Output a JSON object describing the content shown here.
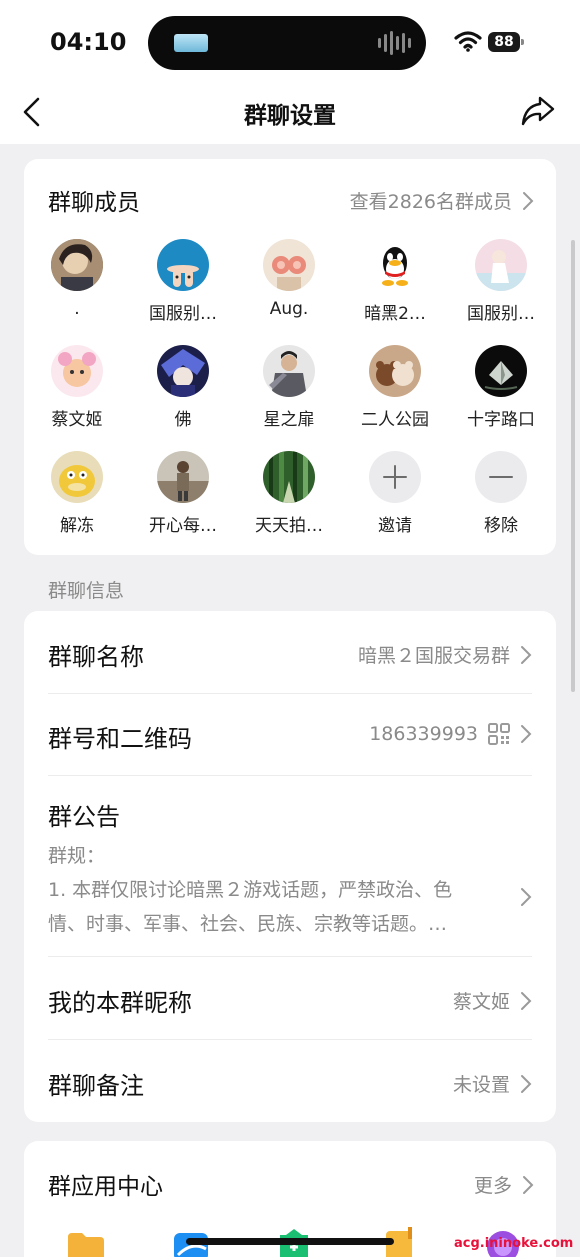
{
  "status_bar": {
    "time": "04:10",
    "battery": "88"
  },
  "nav": {
    "title": "群聊设置"
  },
  "members": {
    "title": "群聊成员",
    "view_all": "查看2826名群成员",
    "items": [
      {
        "name": "."
      },
      {
        "name": "国服别…"
      },
      {
        "name": "Aug."
      },
      {
        "name": "暗黑2…"
      },
      {
        "name": "国服别…"
      },
      {
        "name": "蔡文姬"
      },
      {
        "name": "佛"
      },
      {
        "name": "星之扉"
      },
      {
        "name": "二人公园"
      },
      {
        "name": "十字路口"
      },
      {
        "name": "解冻"
      },
      {
        "name": "开心每…"
      },
      {
        "name": "天天拍…"
      }
    ],
    "invite_label": "邀请",
    "remove_label": "移除"
  },
  "info_section_label": "群聊信息",
  "info": {
    "name_label": "群聊名称",
    "name_value": "暗黑２国服交易群",
    "number_label": "群号和二维码",
    "number_value": "186339993",
    "notice_label": "群公告",
    "notice_line1": "群规：",
    "notice_line2": "1. 本群仅限讨论暗黑２游戏话题，严禁政治、色",
    "notice_line3": "情、时事、军事、社会、民族、宗教等话题。…",
    "nickname_label": "我的本群昵称",
    "nickname_value": "蔡文姬",
    "remark_label": "群聊备注",
    "remark_value": "未设置"
  },
  "apps": {
    "title": "群应用中心",
    "more": "更多"
  },
  "watermark": "acg.ininoke.com"
}
